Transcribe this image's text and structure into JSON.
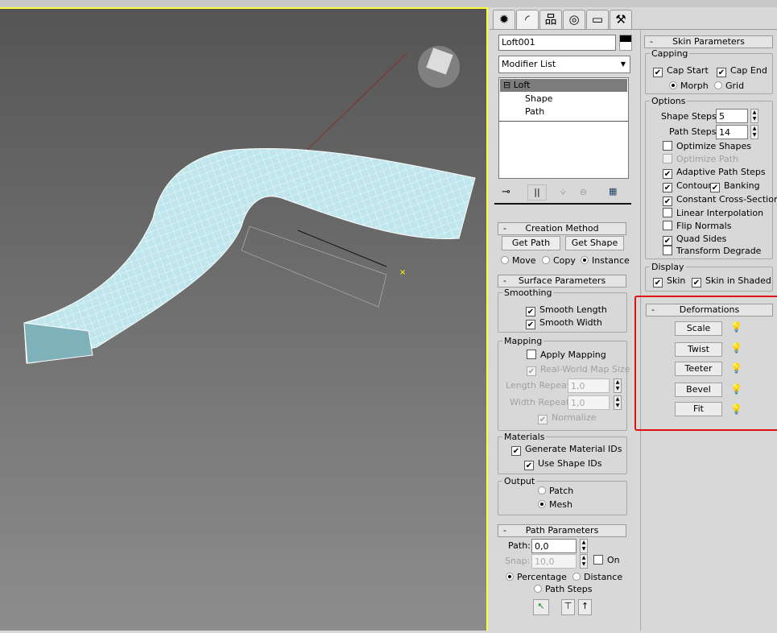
{
  "command_panel": {
    "tabs": [
      {
        "icon": "create-icon",
        "glyph": "✹"
      },
      {
        "icon": "modify-icon",
        "glyph": "◜"
      },
      {
        "icon": "hierarchy-icon",
        "glyph": "品"
      },
      {
        "icon": "motion-icon",
        "glyph": "◎"
      },
      {
        "icon": "display-icon",
        "glyph": "▭"
      },
      {
        "icon": "utilities-icon",
        "glyph": "⚒"
      }
    ],
    "object_name": "Loft001",
    "object_color": "#000000",
    "modifier_list": "Modifier List",
    "stack": {
      "root": "Loft",
      "children": [
        "Shape",
        "Path"
      ]
    }
  },
  "creation_method": {
    "title": "Creation Method",
    "get_path": "Get Path",
    "get_shape": "Get Shape",
    "move": "Move",
    "copy": "Copy",
    "instance": "Instance",
    "selected": "Instance"
  },
  "surface_parameters": {
    "title": "Surface Parameters",
    "smoothing": "Smoothing",
    "smooth_length": "Smooth Length",
    "smooth_width": "Smooth Width",
    "mapping": "Mapping",
    "apply_mapping": "Apply Mapping",
    "real_world": "Real-World Map Size",
    "length_repeat_label": "Length Repeat:",
    "length_repeat": "1,0",
    "width_repeat_label": "Width Repeat:",
    "width_repeat": "1,0",
    "normalize": "Normalize",
    "materials": "Materials",
    "gen_mat_ids": "Generate Material IDs",
    "use_shape_ids": "Use Shape IDs",
    "output": "Output",
    "patch": "Patch",
    "mesh": "Mesh",
    "selected_output": "Mesh"
  },
  "path_parameters": {
    "title": "Path Parameters",
    "path_label": "Path:",
    "path": "0,0",
    "snap_label": "Snap:",
    "snap": "10,0",
    "on": "On",
    "percentage": "Percentage",
    "distance": "Distance",
    "path_steps": "Path Steps",
    "selected": "Percentage"
  },
  "skin_parameters": {
    "title": "Skin Parameters",
    "capping": "Capping",
    "cap_start": "Cap Start",
    "cap_end": "Cap End",
    "morph": "Morph",
    "grid": "Grid",
    "options": "Options",
    "shape_steps_label": "Shape Steps:",
    "shape_steps": "5",
    "path_steps_label": "Path Steps:",
    "path_steps": "14",
    "optimize_shapes": "Optimize Shapes",
    "optimize_path": "Optimize Path",
    "adaptive_path_steps": "Adaptive Path Steps",
    "contour": "Contour",
    "banking": "Banking",
    "constant_cross_section": "Constant Cross-Section",
    "linear_interpolation": "Linear Interpolation",
    "flip_normals": "Flip Normals",
    "quad_sides": "Quad Sides",
    "transform_degrade": "Transform Degrade",
    "display": "Display",
    "skin": "Skin",
    "skin_in_shaded": "Skin in Shaded"
  },
  "deformations": {
    "title": "Deformations",
    "buttons": [
      "Scale",
      "Twist",
      "Teeter",
      "Bevel",
      "Fit"
    ],
    "highlight_color": "#e01010"
  },
  "checkmark": "✔",
  "viewport": {
    "border_color": "#ffff3a",
    "mesh_color": "#bfe6ec"
  }
}
